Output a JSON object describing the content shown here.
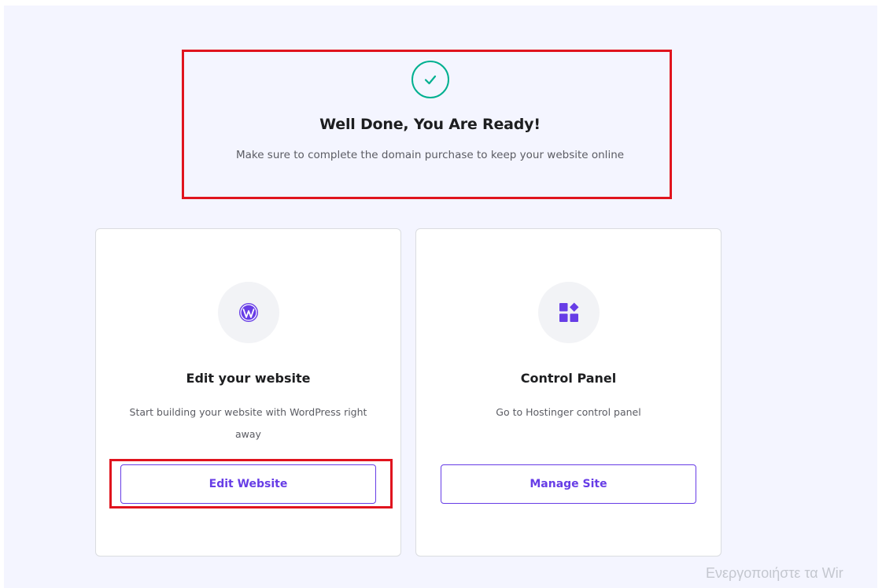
{
  "hero": {
    "title": "Well Done, You Are Ready!",
    "subtitle": "Make sure to complete the domain purchase to keep your website online",
    "icon": "check-circle-icon",
    "accent_color": "#00b090"
  },
  "cards": [
    {
      "icon": "wordpress-icon",
      "title": "Edit your website",
      "description": "Start building your website with WordPress right away",
      "button_label": "Edit Website"
    },
    {
      "icon": "control-panel-icon",
      "title": "Control Panel",
      "description": "Go to Hostinger control panel",
      "button_label": "Manage Site"
    }
  ],
  "colors": {
    "brand": "#673de6",
    "highlight": "#e0141e",
    "background": "#f4f5ff"
  },
  "watermark": "Ενεργοποιήστε τα Wir"
}
